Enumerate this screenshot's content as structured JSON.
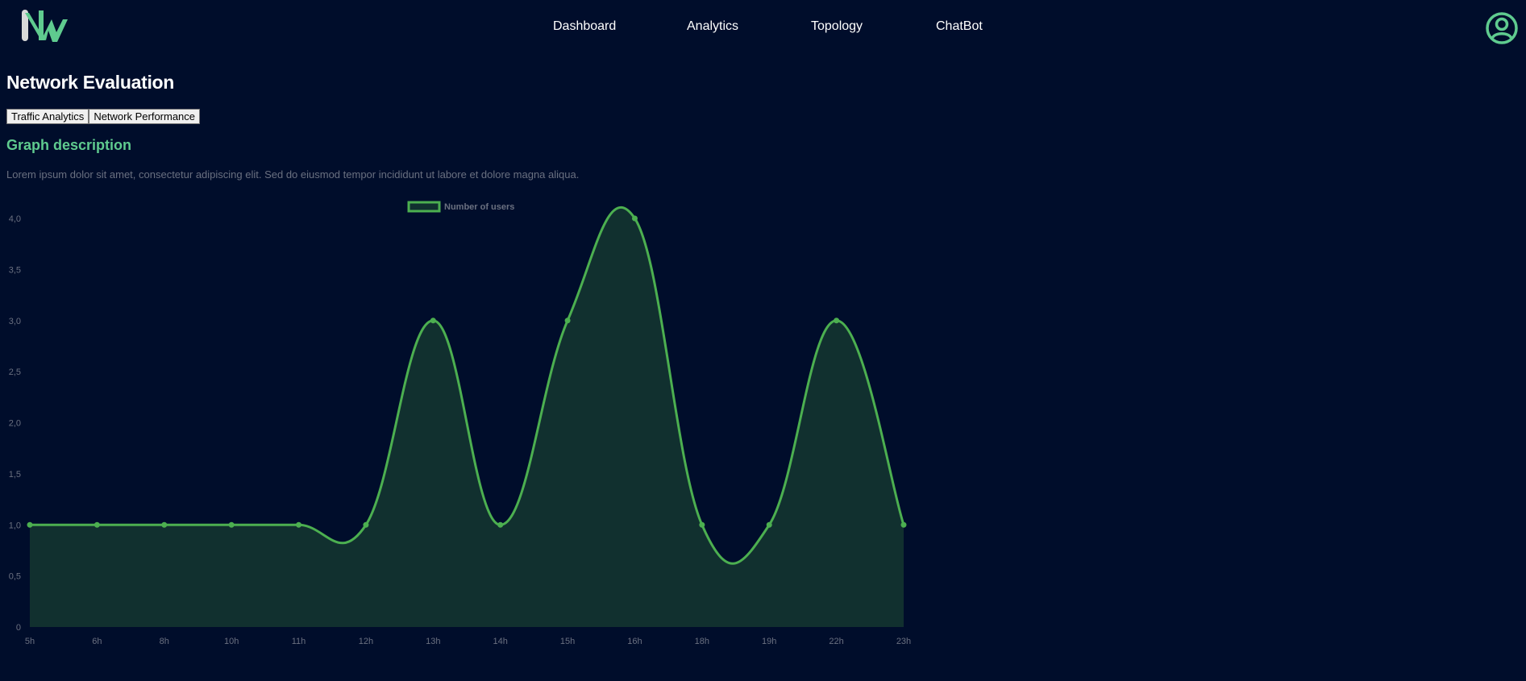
{
  "nav": {
    "items": [
      {
        "label": "Dashboard"
      },
      {
        "label": "Analytics"
      },
      {
        "label": "Topology"
      },
      {
        "label": "ChatBot"
      }
    ]
  },
  "colors": {
    "background": "#000d2b",
    "accent": "#5fcb8f",
    "line": "#4caf50",
    "area": "#11302f",
    "muted_text": "#6a7080"
  },
  "icons": {
    "logo": "nw-logo",
    "user": "user-circle-icon"
  },
  "page": {
    "title": "Network Evaluation"
  },
  "tabs": [
    {
      "label": "Traffic Analytics"
    },
    {
      "label": "Network Performance"
    }
  ],
  "graph": {
    "heading": "Graph description",
    "description": "Lorem ipsum dolor sit amet, consectetur adipiscing elit. Sed do eiusmod tempor incididunt ut labore et dolore magna aliqua."
  },
  "chart_data": {
    "type": "area",
    "categories": [
      "5h",
      "6h",
      "8h",
      "10h",
      "11h",
      "12h",
      "13h",
      "14h",
      "15h",
      "16h",
      "18h",
      "19h",
      "22h",
      "23h"
    ],
    "series": [
      {
        "name": "Number of users",
        "values": [
          1,
          1,
          1,
          1,
          1,
          1,
          3,
          1,
          3,
          4,
          1,
          1,
          3,
          1
        ]
      }
    ],
    "yticks": [
      "0",
      "0,5",
      "1,0",
      "1,5",
      "2,0",
      "2,5",
      "3,0",
      "3,5",
      "4,0"
    ],
    "ylim": [
      0,
      4
    ],
    "grid": false,
    "legend": "top-center"
  }
}
